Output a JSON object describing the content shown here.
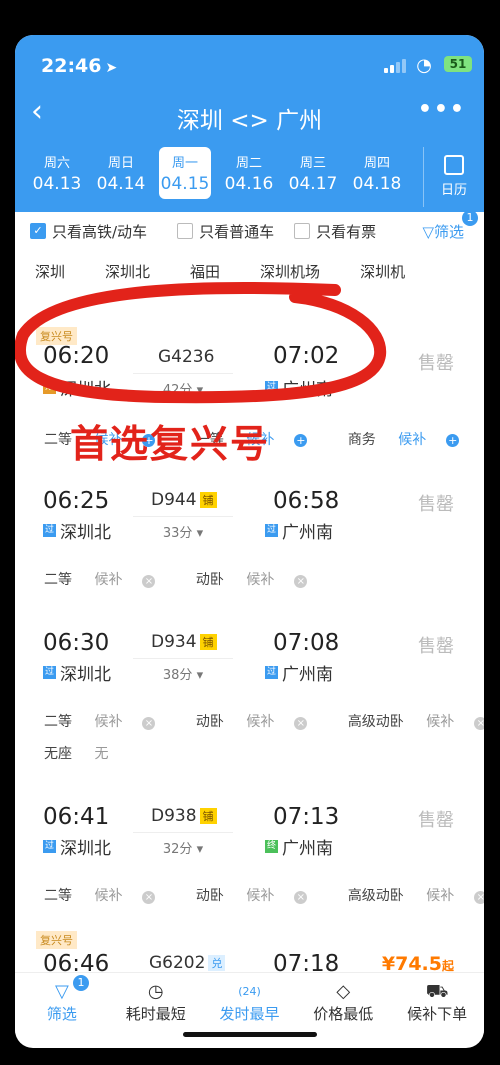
{
  "status": {
    "time": "22:46",
    "battery": "51"
  },
  "nav": {
    "back_icon": "chevron-left-icon",
    "title": "深圳 <> 广州",
    "more": "•••"
  },
  "dates": [
    {
      "weekday": "周六",
      "date": "04.13"
    },
    {
      "weekday": "周日",
      "date": "04.14"
    },
    {
      "weekday": "周一",
      "date": "04.15",
      "selected": true
    },
    {
      "weekday": "周二",
      "date": "04.16"
    },
    {
      "weekday": "周三",
      "date": "04.17"
    },
    {
      "weekday": "周四",
      "date": "04.18"
    }
  ],
  "calendar_label": "日历",
  "filters": {
    "only_gaotie": "只看高铁/动车",
    "only_putong": "只看普通车",
    "only_available": "只看有票",
    "filter_label": "筛选",
    "filter_badge": "1"
  },
  "stations": [
    "深圳",
    "深圳北",
    "福田",
    "深圳机场",
    "深圳机"
  ],
  "trains": [
    {
      "badge": "复兴号",
      "dep": "06:20",
      "num": "G4236",
      "arr": "07:02",
      "dur": "42分",
      "from": "深圳北",
      "from_tag": "始",
      "to": "广州南",
      "to_tag": "过",
      "status": "售罄",
      "seats": [
        {
          "cls": "二等",
          "val": "候补"
        },
        {
          "cls": "一等",
          "val": "候补"
        },
        {
          "cls": "商务",
          "val": "候补"
        }
      ]
    },
    {
      "dep": "06:25",
      "num": "D944",
      "pu": "铺",
      "arr": "06:58",
      "dur": "33分",
      "from": "深圳北",
      "from_tag": "过",
      "to": "广州南",
      "to_tag": "过",
      "status": "售罄",
      "seats": [
        {
          "cls": "二等",
          "val": "候补"
        },
        {
          "cls": "动卧",
          "val": "候补"
        }
      ]
    },
    {
      "dep": "06:30",
      "num": "D934",
      "pu": "铺",
      "arr": "07:08",
      "dur": "38分",
      "from": "深圳北",
      "from_tag": "过",
      "to": "广州南",
      "to_tag": "过",
      "status": "售罄",
      "seats": [
        {
          "cls": "二等",
          "val": "候补"
        },
        {
          "cls": "动卧",
          "val": "候补"
        },
        {
          "cls": "高级动卧",
          "val": "候补"
        }
      ],
      "extra": {
        "cls": "无座",
        "val": "无"
      }
    },
    {
      "dep": "06:41",
      "num": "D938",
      "pu": "铺",
      "arr": "07:13",
      "dur": "32分",
      "from": "深圳北",
      "from_tag": "过",
      "to": "广州南",
      "to_tag": "终",
      "status": "售罄",
      "seats": [
        {
          "cls": "二等",
          "val": "候补"
        },
        {
          "cls": "动卧",
          "val": "候补"
        },
        {
          "cls": "高级动卧",
          "val": "候补"
        }
      ]
    },
    {
      "badge": "复兴号",
      "dep": "06:46",
      "num": "G6202",
      "dui": "兑",
      "arr": "07:18",
      "price": "¥74.5",
      "price_suffix": "起"
    }
  ],
  "annotation": "首选复兴号",
  "tabbar": [
    {
      "label": "筛选",
      "badge": "1",
      "icon": "filter-icon"
    },
    {
      "label": "耗时最短",
      "icon": "clock-icon"
    },
    {
      "label": "发时最早",
      "icon": "24h-icon",
      "badge_text": "24"
    },
    {
      "label": "价格最低",
      "icon": "price-tag-icon"
    },
    {
      "label": "候补下单",
      "icon": "cart-icon"
    }
  ]
}
